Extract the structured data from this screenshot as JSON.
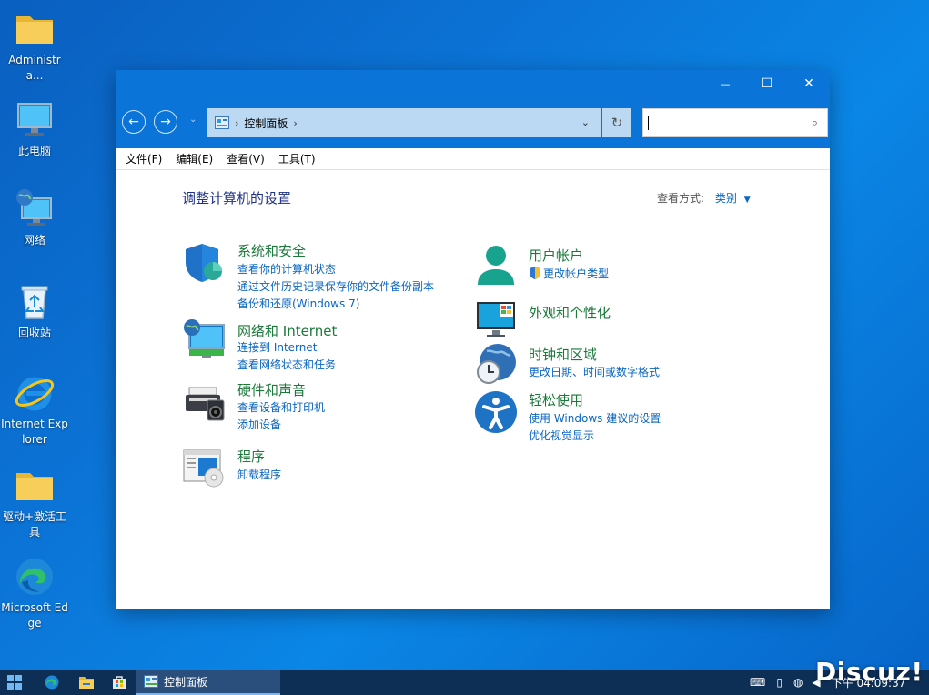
{
  "desktop": {
    "icons": [
      {
        "label": "Administra..."
      },
      {
        "label": "此电脑"
      },
      {
        "label": "网络"
      },
      {
        "label": "回收站"
      },
      {
        "label": "Internet Explorer"
      },
      {
        "label": "驱动+激活工具"
      },
      {
        "label": "Microsoft Edge"
      }
    ]
  },
  "window": {
    "title_buttons": {
      "minimize": "—",
      "maximize": "☐",
      "close": "✕"
    },
    "nav": {
      "back": "←",
      "forward": "→",
      "recent": "⌄"
    },
    "address": {
      "crumb": "控制面板",
      "separator": "›"
    },
    "search": {
      "placeholder": "",
      "value": ""
    },
    "menu": [
      "文件(F)",
      "编辑(E)",
      "查看(V)",
      "工具(T)"
    ]
  },
  "content": {
    "title": "调整计算机的设置",
    "view_by_label": "查看方式:",
    "view_by_value": "类别",
    "categories_left": [
      {
        "title": "系统和安全",
        "icon": "shield-icon",
        "links": [
          "查看你的计算机状态",
          "通过文件历史记录保存你的文件备份副本",
          "备份和还原(Windows 7)"
        ]
      },
      {
        "title": "网络和 Internet",
        "icon": "network-icon",
        "links": [
          "连接到 Internet",
          "查看网络状态和任务"
        ]
      },
      {
        "title": "硬件和声音",
        "icon": "printer-icon",
        "links": [
          "查看设备和打印机",
          "添加设备"
        ]
      },
      {
        "title": "程序",
        "icon": "programs-icon",
        "links": [
          "卸载程序"
        ]
      }
    ],
    "categories_right": [
      {
        "title": "用户帐户",
        "icon": "user-icon",
        "links": [
          "更改帐户类型"
        ]
      },
      {
        "title": "外观和个性化",
        "icon": "monitor-icon",
        "links": []
      },
      {
        "title": "时钟和区域",
        "icon": "clock-globe-icon",
        "links": [
          "更改日期、时间或数字格式"
        ]
      },
      {
        "title": "轻松使用",
        "icon": "accessibility-icon",
        "links": [
          "使用 Windows 建议的设置",
          "优化视觉显示"
        ]
      }
    ]
  },
  "taskbar": {
    "active_window": "控制面板",
    "clock": "下午 04:09:37"
  },
  "watermark": "Discuz!",
  "colors": {
    "accent": "#0a74d8",
    "link": "#0a66c2",
    "category_title": "#1b7a3a"
  }
}
